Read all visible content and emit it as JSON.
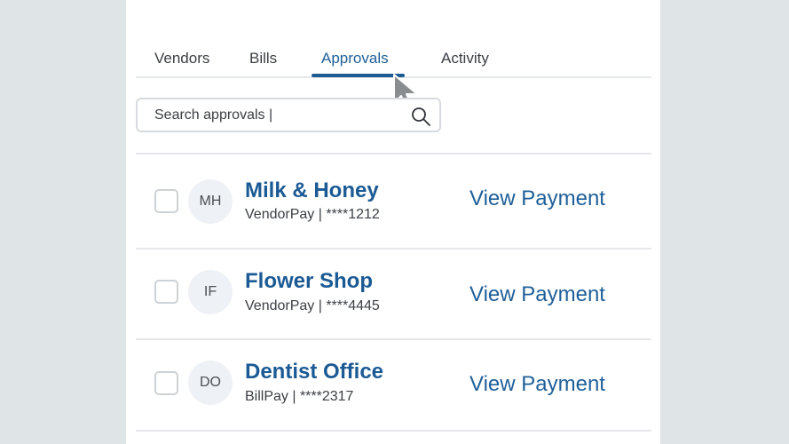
{
  "tabs": [
    {
      "label": "Vendors"
    },
    {
      "label": "Bills"
    },
    {
      "label": "Approvals"
    },
    {
      "label": "Activity"
    }
  ],
  "active_tab": "Approvals",
  "search": {
    "placeholder": "Search approvals |"
  },
  "rows": [
    {
      "initials": "MH",
      "name": "Milk & Honey",
      "subtitle": "VendorPay | ****1212",
      "action": "View Payment"
    },
    {
      "initials": "IF",
      "name": "Flower Shop",
      "subtitle": "VendorPay | ****4445",
      "action": "View Payment"
    },
    {
      "initials": "DO",
      "name": "Dentist Office",
      "subtitle": "BillPay | ****2317",
      "action": "View Payment"
    }
  ],
  "colors": {
    "accent": "#1e5b93",
    "background": "#dfe4e7",
    "panel": "#ffffff"
  },
  "icons": [
    "search-icon",
    "mouse-pointer-icon"
  ]
}
